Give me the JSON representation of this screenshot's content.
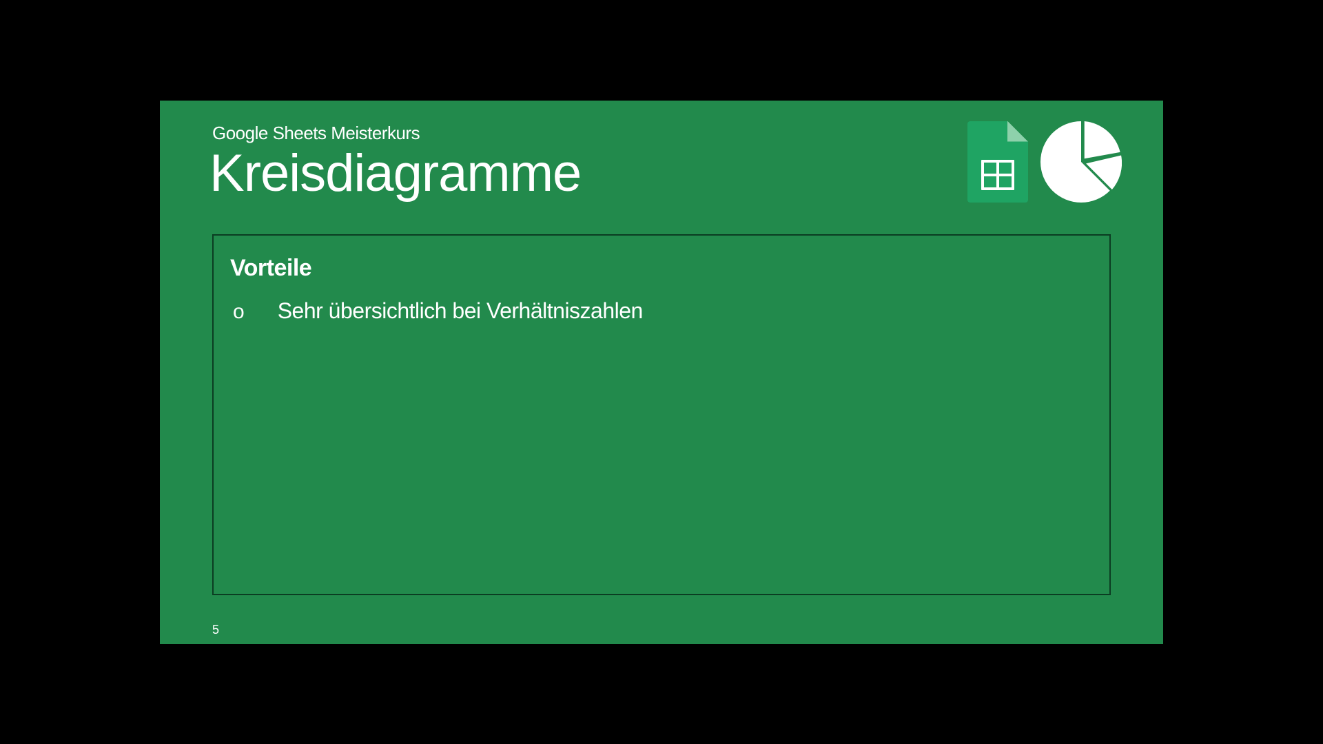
{
  "header": {
    "subtitle": "Google Sheets Meisterkurs",
    "title": "Kreisdiagramme"
  },
  "icons": {
    "sheets": "google-sheets-icon",
    "pie": "pie-chart-icon"
  },
  "content": {
    "section_heading": "Vorteile",
    "bullets": [
      {
        "marker": "o",
        "text": "Sehr übersichtlich bei Verhältniszahlen"
      }
    ]
  },
  "footer": {
    "page_number": "5"
  }
}
